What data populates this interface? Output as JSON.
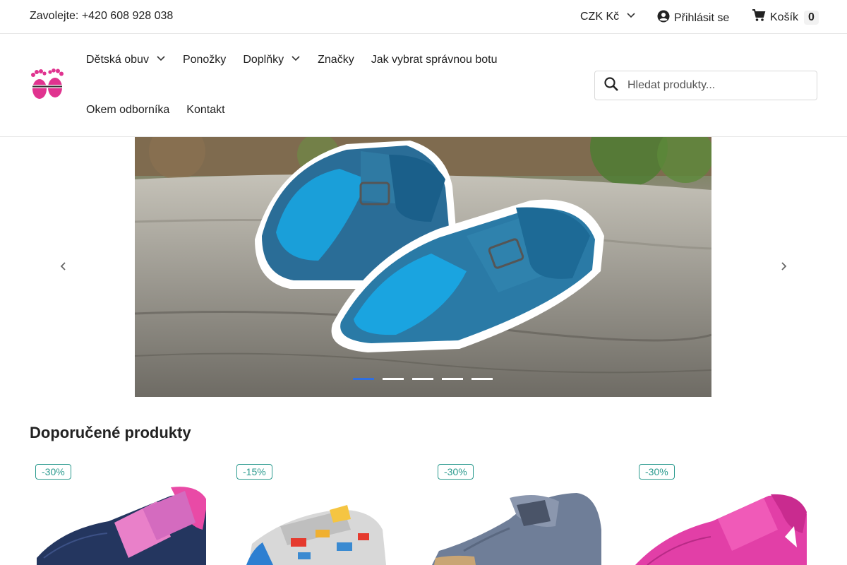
{
  "topbar": {
    "phone": "Zavolejte: +420 608 928 038",
    "currency": "CZK Kč",
    "login": "Přihlásit se",
    "cart_label": "Košík",
    "cart_count": "0"
  },
  "nav": {
    "items": [
      {
        "label": "Dětská obuv"
      },
      {
        "label": "Ponožky"
      },
      {
        "label": "Doplňky"
      },
      {
        "label": "Značky"
      },
      {
        "label": "Jak vybrat správnou botu"
      },
      {
        "label": "Okem odborníka"
      },
      {
        "label": "Kontakt"
      }
    ]
  },
  "search": {
    "placeholder": "Hledat produkty..."
  },
  "slider": {
    "slide_count": 5,
    "active_index": 0
  },
  "featured": {
    "title": "Doporučené produkty",
    "products": [
      {
        "discount": "-30%"
      },
      {
        "discount": "-15%"
      },
      {
        "discount": "-30%"
      },
      {
        "discount": "-30%"
      }
    ]
  },
  "colors": {
    "accent": "#2f6fe0",
    "badge": "#2a9a8e",
    "logo": "#e0338f"
  }
}
